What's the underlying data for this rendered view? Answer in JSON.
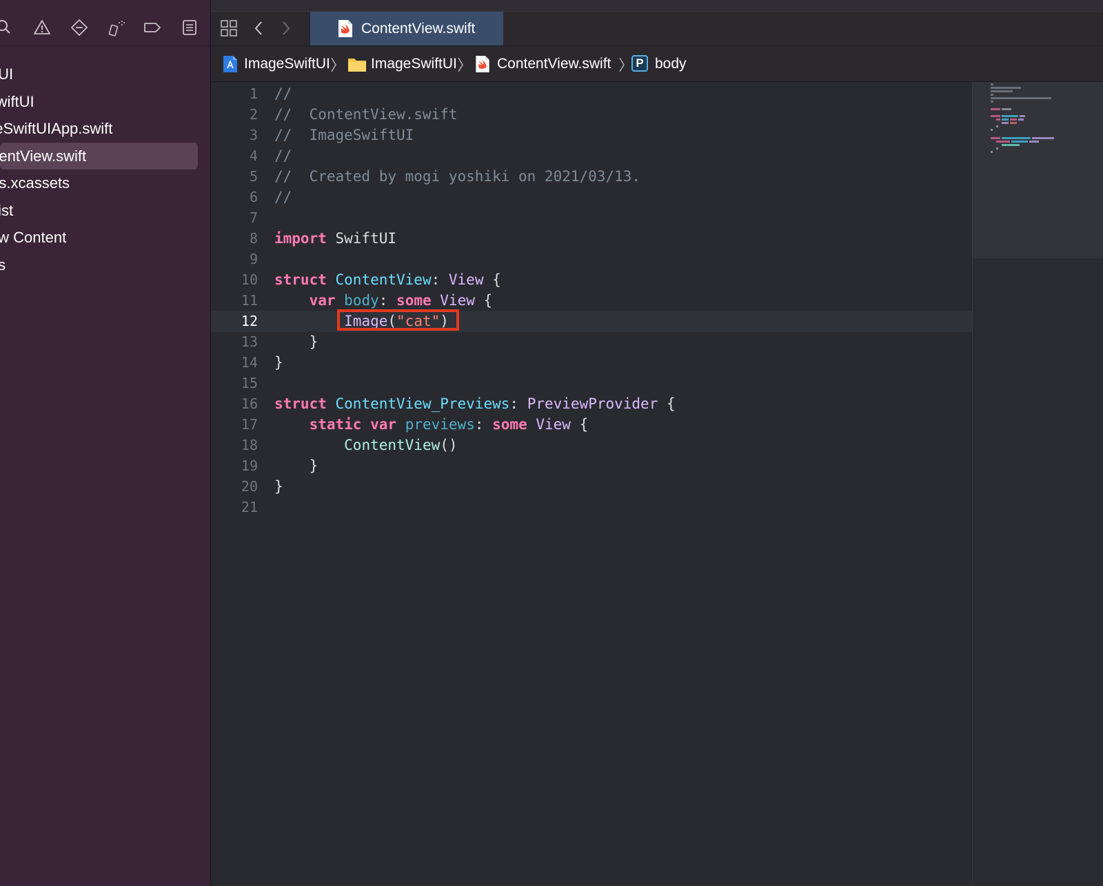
{
  "sidebar": {
    "items": [
      {
        "label": "iftUI",
        "selected": false
      },
      {
        "label": "SwiftUI",
        "selected": false
      },
      {
        "label": "geSwiftUIApp.swift",
        "selected": false
      },
      {
        "label": "ntentView.swift",
        "selected": true
      },
      {
        "label": "ets.xcassets",
        "selected": false
      },
      {
        "label": "plist",
        "selected": false
      },
      {
        "label": "iew Content",
        "selected": false
      },
      {
        "label": "cts",
        "selected": false
      }
    ]
  },
  "tab": {
    "label": "ContentView.swift"
  },
  "breadcrumb": {
    "project": "ImageSwiftUI",
    "folder": "ImageSwiftUI",
    "file": "ContentView.swift",
    "symbol_badge": "P",
    "symbol": "body"
  },
  "editor": {
    "current_line": "12",
    "lines": [
      {
        "n": "1",
        "tokens": [
          {
            "t": "//",
            "c": "comment"
          }
        ]
      },
      {
        "n": "2",
        "tokens": [
          {
            "t": "//  ContentView.swift",
            "c": "comment"
          }
        ]
      },
      {
        "n": "3",
        "tokens": [
          {
            "t": "//  ImageSwiftUI",
            "c": "comment"
          }
        ]
      },
      {
        "n": "4",
        "tokens": [
          {
            "t": "//",
            "c": "comment"
          }
        ]
      },
      {
        "n": "5",
        "tokens": [
          {
            "t": "//  Created by mogi yoshiki on 2021/03/13.",
            "c": "comment"
          }
        ]
      },
      {
        "n": "6",
        "tokens": [
          {
            "t": "//",
            "c": "comment"
          }
        ]
      },
      {
        "n": "7",
        "tokens": []
      },
      {
        "n": "8",
        "tokens": [
          {
            "t": "import",
            "c": "kw"
          },
          {
            "t": " SwiftUI",
            "c": "plain"
          }
        ]
      },
      {
        "n": "9",
        "tokens": []
      },
      {
        "n": "10",
        "tokens": [
          {
            "t": "struct",
            "c": "kw"
          },
          {
            "t": " ",
            "c": "plain"
          },
          {
            "t": "ContentView",
            "c": "decl"
          },
          {
            "t": ": ",
            "c": "plain"
          },
          {
            "t": "View",
            "c": "type"
          },
          {
            "t": " {",
            "c": "plain"
          }
        ]
      },
      {
        "n": "11",
        "tokens": [
          {
            "t": "    ",
            "c": "plain"
          },
          {
            "t": "var",
            "c": "kw"
          },
          {
            "t": " ",
            "c": "plain"
          },
          {
            "t": "body",
            "c": "prop"
          },
          {
            "t": ": ",
            "c": "plain"
          },
          {
            "t": "some",
            "c": "kw"
          },
          {
            "t": " ",
            "c": "plain"
          },
          {
            "t": "View",
            "c": "type"
          },
          {
            "t": " {",
            "c": "plain"
          }
        ]
      },
      {
        "n": "12",
        "tokens": [
          {
            "t": "        ",
            "c": "plain"
          },
          {
            "t": "Image",
            "c": "type"
          },
          {
            "t": "(",
            "c": "plain"
          },
          {
            "t": "\"cat\"",
            "c": "str"
          },
          {
            "t": ")",
            "c": "plain"
          }
        ]
      },
      {
        "n": "13",
        "tokens": [
          {
            "t": "    }",
            "c": "plain"
          }
        ]
      },
      {
        "n": "14",
        "tokens": [
          {
            "t": "}",
            "c": "plain"
          }
        ]
      },
      {
        "n": "15",
        "tokens": []
      },
      {
        "n": "16",
        "tokens": [
          {
            "t": "struct",
            "c": "kw"
          },
          {
            "t": " ",
            "c": "plain"
          },
          {
            "t": "ContentView_Previews",
            "c": "decl"
          },
          {
            "t": ": ",
            "c": "plain"
          },
          {
            "t": "PreviewProvider",
            "c": "type"
          },
          {
            "t": " {",
            "c": "plain"
          }
        ]
      },
      {
        "n": "17",
        "tokens": [
          {
            "t": "    ",
            "c": "plain"
          },
          {
            "t": "static",
            "c": "kw"
          },
          {
            "t": " ",
            "c": "plain"
          },
          {
            "t": "var",
            "c": "kw"
          },
          {
            "t": " ",
            "c": "plain"
          },
          {
            "t": "previews",
            "c": "prop"
          },
          {
            "t": ": ",
            "c": "plain"
          },
          {
            "t": "some",
            "c": "kw"
          },
          {
            "t": " ",
            "c": "plain"
          },
          {
            "t": "View",
            "c": "type"
          },
          {
            "t": " {",
            "c": "plain"
          }
        ]
      },
      {
        "n": "18",
        "tokens": [
          {
            "t": "        ",
            "c": "plain"
          },
          {
            "t": "ContentView",
            "c": "other"
          },
          {
            "t": "()",
            "c": "plain"
          }
        ]
      },
      {
        "n": "19",
        "tokens": [
          {
            "t": "    }",
            "c": "plain"
          }
        ]
      },
      {
        "n": "20",
        "tokens": [
          {
            "t": "}",
            "c": "plain"
          }
        ]
      },
      {
        "n": "21",
        "tokens": []
      }
    ]
  },
  "colors": {
    "sidebar_bg": "#3a2437",
    "editor_bg": "#292a30",
    "tab_active": "#3a4d6b",
    "highlight_box": "#e03a1f",
    "keyword": "#ff7ab2",
    "type": "#dabaff",
    "declaration": "#6bdfff",
    "string": "#ff8170",
    "comment": "#7f8c98"
  }
}
